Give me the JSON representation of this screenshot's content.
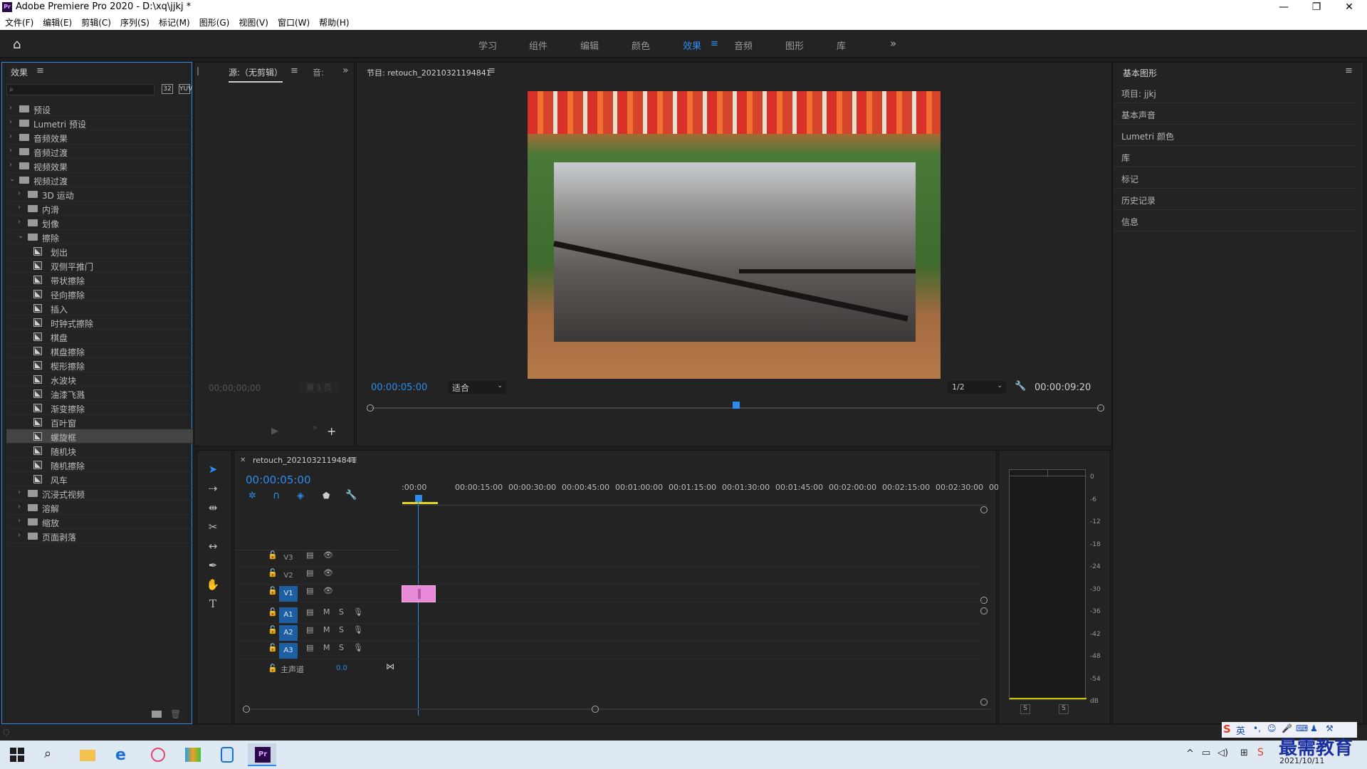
{
  "window": {
    "title": "Adobe Premiere Pro 2020 - D:\\xq\\jjkj *",
    "logo": "Pr",
    "minimize": "—",
    "restore": "❐",
    "close": "✕"
  },
  "menu": [
    "文件(F)",
    "编辑(E)",
    "剪辑(C)",
    "序列(S)",
    "标记(M)",
    "图形(G)",
    "视图(V)",
    "窗口(W)",
    "帮助(H)"
  ],
  "workspaces": [
    "学习",
    "组件",
    "编辑",
    "颜色",
    "效果",
    "音频",
    "图形",
    "库"
  ],
  "active_workspace": "效果",
  "effects_panel": {
    "title": "效果",
    "tree": [
      {
        "label": "预设",
        "level": 0,
        "kind": "folder",
        "arrow": "›"
      },
      {
        "label": "Lumetri 预设",
        "level": 0,
        "kind": "folder",
        "arrow": "›"
      },
      {
        "label": "音频效果",
        "level": 0,
        "kind": "folder",
        "arrow": "›"
      },
      {
        "label": "音频过渡",
        "level": 0,
        "kind": "folder",
        "arrow": "›"
      },
      {
        "label": "视频效果",
        "level": 0,
        "kind": "folder",
        "arrow": "›"
      },
      {
        "label": "视频过渡",
        "level": 0,
        "kind": "folder",
        "arrow": "⌄"
      },
      {
        "label": "3D 运动",
        "level": 1,
        "kind": "folder",
        "arrow": "›"
      },
      {
        "label": "内滑",
        "level": 1,
        "kind": "folder",
        "arrow": "›"
      },
      {
        "label": "划像",
        "level": 1,
        "kind": "folder",
        "arrow": "›"
      },
      {
        "label": "擦除",
        "level": 1,
        "kind": "folder",
        "arrow": "⌄"
      },
      {
        "label": "划出",
        "level": 2,
        "kind": "fx"
      },
      {
        "label": "双侧平推门",
        "level": 2,
        "kind": "fx"
      },
      {
        "label": "带状擦除",
        "level": 2,
        "kind": "fx"
      },
      {
        "label": "径向擦除",
        "level": 2,
        "kind": "fx"
      },
      {
        "label": "插入",
        "level": 2,
        "kind": "fx"
      },
      {
        "label": "时钟式擦除",
        "level": 2,
        "kind": "fx"
      },
      {
        "label": "棋盘",
        "level": 2,
        "kind": "fx"
      },
      {
        "label": "棋盘擦除",
        "level": 2,
        "kind": "fx"
      },
      {
        "label": "楔形擦除",
        "level": 2,
        "kind": "fx"
      },
      {
        "label": "水波块",
        "level": 2,
        "kind": "fx"
      },
      {
        "label": "油漆飞溅",
        "level": 2,
        "kind": "fx"
      },
      {
        "label": "渐变擦除",
        "level": 2,
        "kind": "fx"
      },
      {
        "label": "百叶窗",
        "level": 2,
        "kind": "fx"
      },
      {
        "label": "螺旋框",
        "level": 2,
        "kind": "fx",
        "selected": true
      },
      {
        "label": "随机块",
        "level": 2,
        "kind": "fx"
      },
      {
        "label": "随机擦除",
        "level": 2,
        "kind": "fx"
      },
      {
        "label": "风车",
        "level": 2,
        "kind": "fx"
      },
      {
        "label": "沉浸式视频",
        "level": 1,
        "kind": "folder",
        "arrow": "›"
      },
      {
        "label": "溶解",
        "level": 1,
        "kind": "folder",
        "arrow": "›"
      },
      {
        "label": "缩放",
        "level": 1,
        "kind": "folder",
        "arrow": "›"
      },
      {
        "label": "页面剥落",
        "level": 1,
        "kind": "folder",
        "arrow": "›"
      }
    ]
  },
  "source_panel": {
    "tab": "源:（无剪辑）",
    "tab2": "音:",
    "timecode": "00;00;00;00",
    "page": "第 1 页"
  },
  "program_panel": {
    "title": "节目: retouch_20210321194841",
    "timecode_current": "00:00:05:00",
    "fit": "适合",
    "resolution": "1/2",
    "timecode_duration": "00:00:09:20",
    "playhead_fraction": 0.5
  },
  "right_panel": {
    "title": "基本图形",
    "items": [
      "项目: jjkj",
      "基本声音",
      "Lumetri 颜色",
      "库",
      "标记",
      "历史记录",
      "信息"
    ]
  },
  "timeline": {
    "tab": "retouch_20210321194841",
    "timecode": "00:00:05:00",
    "ruler": [
      ":00:00",
      "00:00:15:00",
      "00:00:30:00",
      "00:00:45:00",
      "00:01:00:00",
      "00:01:15:00",
      "00:01:30:00",
      "00:01:45:00",
      "00:02:00:00",
      "00:02:15:00",
      "00:02:30:00",
      "00:"
    ],
    "video_tracks": [
      "V3",
      "V2",
      "V1"
    ],
    "audio_tracks": [
      "A1",
      "A2",
      "A3"
    ],
    "master": {
      "label": "主声道",
      "value": "0.0"
    },
    "mute": "M",
    "solo": "S"
  },
  "meter": {
    "scale": [
      "0",
      "-6",
      "-12",
      "-18",
      "-24",
      "-30",
      "-36",
      "-42",
      "-48",
      "-54",
      "dB"
    ],
    "solo": [
      "S",
      "S"
    ]
  },
  "taskbar": {
    "date": "2021/10/11",
    "ime": "英",
    "watermark": "最需教育"
  },
  "colors": {
    "accent": "#2d8ceb",
    "clip": "#e88ad8",
    "panel": "#232323"
  }
}
